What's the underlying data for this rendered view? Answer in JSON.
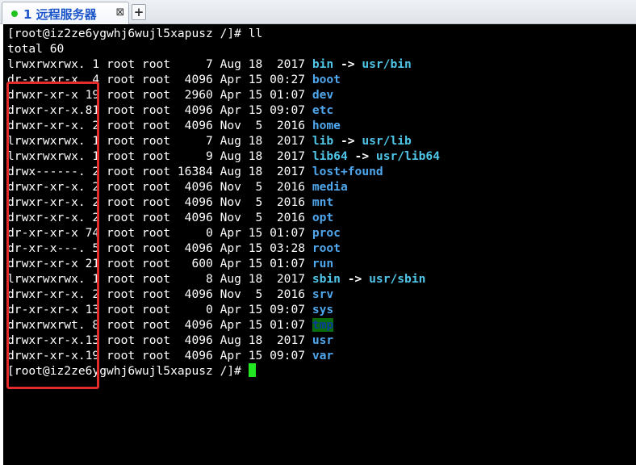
{
  "tabbar": {
    "tab": {
      "status_color": "#21c321",
      "label": "1 远程服务器",
      "close_label": "⊠"
    },
    "new_tab_label": "+"
  },
  "terminal": {
    "prompt_cmd": "[root@iz2ze6ygwhj6wujl5xapusz /]# ll",
    "total_line": "total 60",
    "listing": [
      {
        "perms": "lrwxrwxrwx.",
        "links": "1",
        "owner": "root",
        "group": "root",
        "size": "7",
        "month": "Aug",
        "day": "18",
        "time": "2017",
        "name": "bin",
        "name_type": "link",
        "target": "usr/bin"
      },
      {
        "perms": "dr-xr-xr-x.",
        "links": "4",
        "owner": "root",
        "group": "root",
        "size": "4096",
        "month": "Apr",
        "day": "15",
        "time": "00:27",
        "name": "boot",
        "name_type": "dir",
        "target": ""
      },
      {
        "perms": "drwxr-xr-x",
        "links": "19",
        "owner": "root",
        "group": "root",
        "size": "2960",
        "month": "Apr",
        "day": "15",
        "time": "01:07",
        "name": "dev",
        "name_type": "dir",
        "target": ""
      },
      {
        "perms": "drwxr-xr-x.",
        "links": "81",
        "owner": "root",
        "group": "root",
        "size": "4096",
        "month": "Apr",
        "day": "15",
        "time": "09:07",
        "name": "etc",
        "name_type": "dir",
        "target": ""
      },
      {
        "perms": "drwxr-xr-x.",
        "links": "2",
        "owner": "root",
        "group": "root",
        "size": "4096",
        "month": "Nov",
        "day": "5",
        "time": "2016",
        "name": "home",
        "name_type": "dir",
        "target": ""
      },
      {
        "perms": "lrwxrwxrwx.",
        "links": "1",
        "owner": "root",
        "group": "root",
        "size": "7",
        "month": "Aug",
        "day": "18",
        "time": "2017",
        "name": "lib",
        "name_type": "link",
        "target": "usr/lib"
      },
      {
        "perms": "lrwxrwxrwx.",
        "links": "1",
        "owner": "root",
        "group": "root",
        "size": "9",
        "month": "Aug",
        "day": "18",
        "time": "2017",
        "name": "lib64",
        "name_type": "link",
        "target": "usr/lib64"
      },
      {
        "perms": "drwx------.",
        "links": "2",
        "owner": "root",
        "group": "root",
        "size": "16384",
        "month": "Aug",
        "day": "18",
        "time": "2017",
        "name": "lost+found",
        "name_type": "dir",
        "target": ""
      },
      {
        "perms": "drwxr-xr-x.",
        "links": "2",
        "owner": "root",
        "group": "root",
        "size": "4096",
        "month": "Nov",
        "day": "5",
        "time": "2016",
        "name": "media",
        "name_type": "dir",
        "target": ""
      },
      {
        "perms": "drwxr-xr-x.",
        "links": "2",
        "owner": "root",
        "group": "root",
        "size": "4096",
        "month": "Nov",
        "day": "5",
        "time": "2016",
        "name": "mnt",
        "name_type": "dir",
        "target": ""
      },
      {
        "perms": "drwxr-xr-x.",
        "links": "2",
        "owner": "root",
        "group": "root",
        "size": "4096",
        "month": "Nov",
        "day": "5",
        "time": "2016",
        "name": "opt",
        "name_type": "dir",
        "target": ""
      },
      {
        "perms": "dr-xr-xr-x",
        "links": "74",
        "owner": "root",
        "group": "root",
        "size": "0",
        "month": "Apr",
        "day": "15",
        "time": "01:07",
        "name": "proc",
        "name_type": "dir",
        "target": ""
      },
      {
        "perms": "dr-xr-x---.",
        "links": "5",
        "owner": "root",
        "group": "root",
        "size": "4096",
        "month": "Apr",
        "day": "15",
        "time": "03:28",
        "name": "root",
        "name_type": "dir",
        "target": ""
      },
      {
        "perms": "drwxr-xr-x",
        "links": "21",
        "owner": "root",
        "group": "root",
        "size": "600",
        "month": "Apr",
        "day": "15",
        "time": "01:07",
        "name": "run",
        "name_type": "dir",
        "target": ""
      },
      {
        "perms": "lrwxrwxrwx.",
        "links": "1",
        "owner": "root",
        "group": "root",
        "size": "8",
        "month": "Aug",
        "day": "18",
        "time": "2017",
        "name": "sbin",
        "name_type": "link",
        "target": "usr/sbin"
      },
      {
        "perms": "drwxr-xr-x.",
        "links": "2",
        "owner": "root",
        "group": "root",
        "size": "4096",
        "month": "Nov",
        "day": "5",
        "time": "2016",
        "name": "srv",
        "name_type": "dir",
        "target": ""
      },
      {
        "perms": "dr-xr-xr-x",
        "links": "13",
        "owner": "root",
        "group": "root",
        "size": "0",
        "month": "Apr",
        "day": "15",
        "time": "09:07",
        "name": "sys",
        "name_type": "dir",
        "target": ""
      },
      {
        "perms": "drwxrwxrwt.",
        "links": "8",
        "owner": "root",
        "group": "root",
        "size": "4096",
        "month": "Apr",
        "day": "15",
        "time": "01:07",
        "name": "tmp",
        "name_type": "sticky",
        "target": ""
      },
      {
        "perms": "drwxr-xr-x.",
        "links": "13",
        "owner": "root",
        "group": "root",
        "size": "4096",
        "month": "Aug",
        "day": "18",
        "time": "2017",
        "name": "usr",
        "name_type": "dir",
        "target": ""
      },
      {
        "perms": "drwxr-xr-x.",
        "links": "19",
        "owner": "root",
        "group": "root",
        "size": "4096",
        "month": "Apr",
        "day": "15",
        "time": "09:07",
        "name": "var",
        "name_type": "dir",
        "target": ""
      }
    ],
    "final_prompt": "[root@iz2ze6ygwhj6wujl5xapusz /]# ",
    "link_arrow": "->",
    "colors": {
      "background": "#000000",
      "text": "#ffffff",
      "directory": "#4fa7ee",
      "symlink": "#4fc6e8",
      "sticky_bg": "#0a6b0a",
      "cursor": "#22e622",
      "annotation_box": "#e32b2b"
    }
  }
}
